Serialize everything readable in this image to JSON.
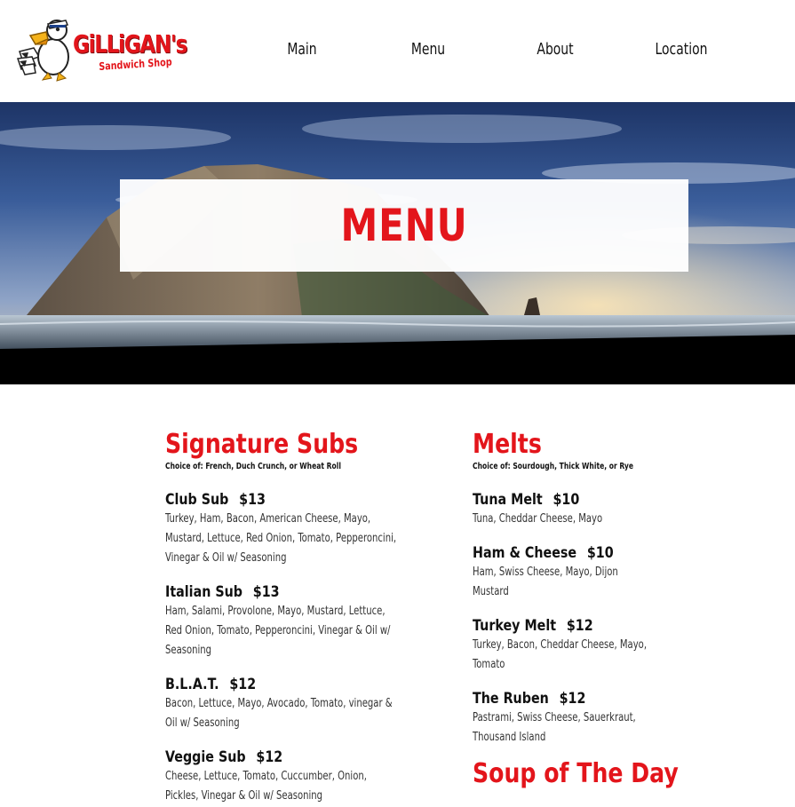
{
  "brand": {
    "name": "GiLLiGAN's",
    "tagline": "Sandwich Shop",
    "accent_color": "#e3151b"
  },
  "nav": {
    "items": [
      "Main",
      "Menu",
      "About",
      "Location"
    ]
  },
  "hero": {
    "title": "MENU"
  },
  "sections": [
    {
      "title": "Signature Subs",
      "note": "Choice of: French, Duch Crunch, or Wheat Roll",
      "items": [
        {
          "name": "Club Sub",
          "price": "$13",
          "desc": "Turkey, Ham, Bacon, American Cheese, Mayo, Mustard, Lettuce, Red Onion, Tomato, Pepperoncini, Vinegar & Oil w/ Seasoning"
        },
        {
          "name": "Italian Sub",
          "price": "$13",
          "desc": "Ham, Salami, Provolone, Mayo, Mustard, Lettuce, Red Onion, Tomato, Pepperoncini, Vinegar & Oil w/ Seasoning"
        },
        {
          "name": "B.L.A.T.",
          "price": "$12",
          "desc": "Bacon, Lettuce, Mayo, Avocado, Tomato, vinegar & Oil w/ Seasoning"
        },
        {
          "name": "Veggie Sub",
          "price": "$12",
          "desc": "Cheese, Lettuce, Tomato, Cuccumber, Onion, Pickles, Vinegar & Oil w/ Seasoning"
        }
      ]
    },
    {
      "title": "Melts",
      "note": "Choice of: Sourdough, Thick White, or Rye",
      "items": [
        {
          "name": "Tuna Melt",
          "price": "$10",
          "desc": "Tuna, Cheddar Cheese, Mayo"
        },
        {
          "name": "Ham & Cheese",
          "price": "$10",
          "desc": "Ham, Swiss Cheese, Mayo, Dijon Mustard"
        },
        {
          "name": "Turkey Melt",
          "price": "$12",
          "desc": "Turkey, Bacon, Cheddar Cheese, Mayo, Tomato"
        },
        {
          "name": "The Ruben",
          "price": "$12",
          "desc": "Pastrami, Swiss Cheese, Sauerkraut, Thousand Island"
        }
      ]
    }
  ],
  "soup": {
    "title": "Soup of The Day"
  }
}
